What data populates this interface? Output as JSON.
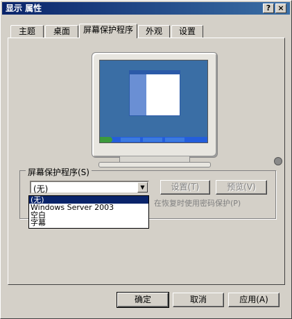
{
  "window": {
    "title": "显示 属性"
  },
  "titlebar": {
    "help_label": "?",
    "close_label": "×"
  },
  "tabs": [
    {
      "label": "主题"
    },
    {
      "label": "桌面"
    },
    {
      "label": "屏幕保护程序"
    },
    {
      "label": "外观"
    },
    {
      "label": "设置"
    }
  ],
  "screensaver": {
    "group_title": "屏幕保护程序(S)",
    "combo_value": "(无)",
    "settings_button": "设置(T)",
    "preview_button": "预览(V)",
    "password_label": "在恢复时使用密码保护(P)",
    "options": [
      {
        "label": "(无)"
      },
      {
        "label": "Windows Server 2003"
      },
      {
        "label": "空白"
      },
      {
        "label": "字幕"
      }
    ]
  },
  "footer": {
    "ok": "确定",
    "cancel": "取消",
    "apply": "应用(A)"
  },
  "colors": {
    "titlebar": "#0a246a",
    "desktop": "#3a6ea5",
    "selection": "#0a246a"
  }
}
